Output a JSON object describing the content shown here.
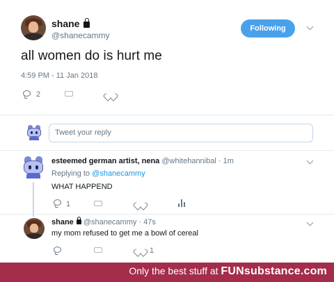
{
  "tweet": {
    "display_name": "shane",
    "handle": "@shanecammy",
    "follow_label": "Following",
    "text": "all women do is hurt me",
    "timestamp": "4:59 PM - 11 Jan 2018",
    "reply_count": "2"
  },
  "reply_box": {
    "placeholder": "Tweet your reply"
  },
  "replies": [
    {
      "display_name": "esteemed german artist, nena",
      "handle": "@whitehannibal · 1m",
      "replying_prefix": "Replying to",
      "replying_to": "@shanecammy",
      "text": "WHAT HAPPEND",
      "reply_count": "1"
    },
    {
      "display_name": "shane",
      "handle": "@shanecammy · 47s",
      "text": "my mom refused to get me a bowl of cereal",
      "like_count": "1"
    }
  ],
  "footer": {
    "prefix": "Only the best stuff at ",
    "brand": "FUNsubstance.com"
  },
  "colors": {
    "accent": "#4aa1eb",
    "link": "#1b95e0",
    "footer_bg": "#a32d4a"
  }
}
